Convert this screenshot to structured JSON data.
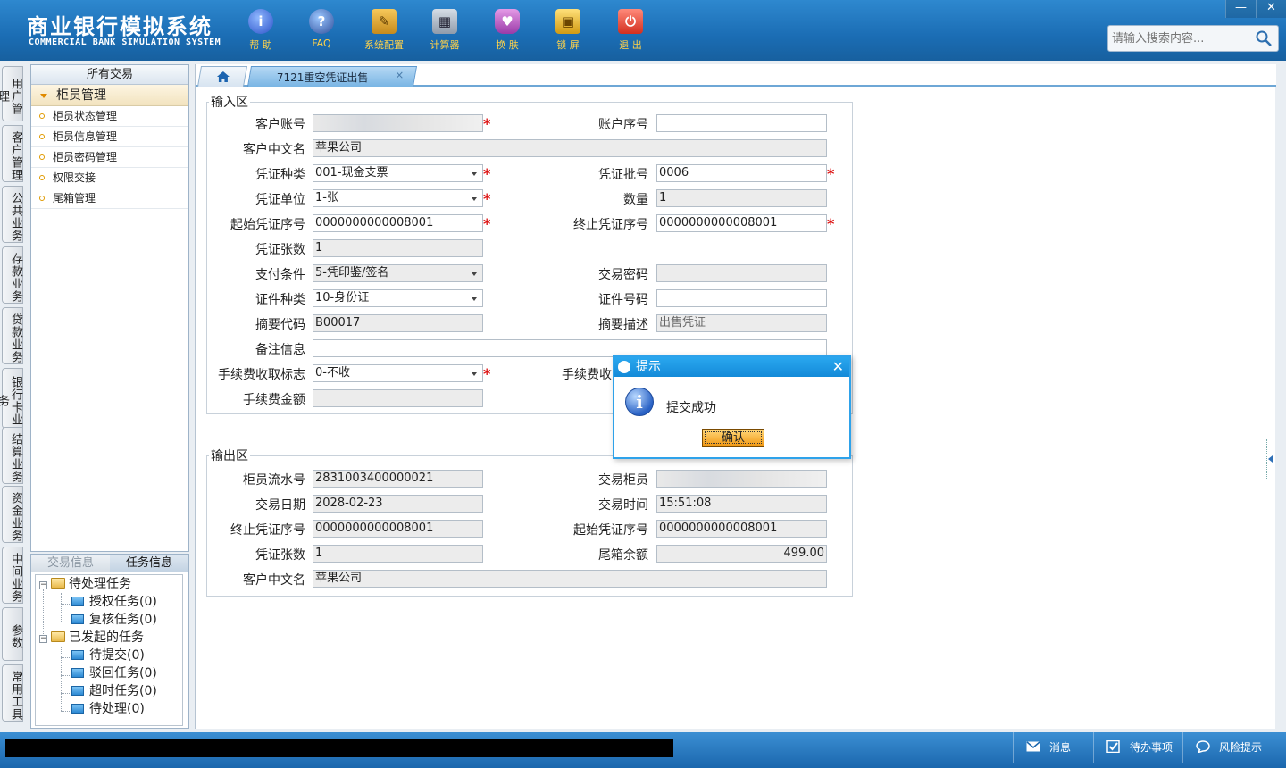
{
  "header": {
    "title_cn": "商业银行模拟系统",
    "title_en": "COMMERCIAL BANK SIMULATION SYSTEM",
    "toolbar": [
      {
        "label": "帮 助",
        "icon": "help-icon"
      },
      {
        "label": "FAQ",
        "icon": "faq-icon"
      },
      {
        "label": "系统配置",
        "icon": "settings-icon"
      },
      {
        "label": "计算器",
        "icon": "calculator-icon"
      },
      {
        "label": "换 肤",
        "icon": "skin-shirt-icon"
      },
      {
        "label": "锁 屏",
        "icon": "lock-icon"
      },
      {
        "label": "退 出",
        "icon": "exit-power-icon"
      }
    ],
    "window_buttons": {
      "minimize": "—",
      "close": "✕"
    },
    "search_placeholder": "请输入搜索内容..."
  },
  "vertical_tabs": [
    "用户管理",
    "客户管理",
    "公共业务",
    "存款业务",
    "贷款业务",
    "银行卡业务",
    "结算业务",
    "资金业务",
    "中间业务",
    "参数",
    "常用工具"
  ],
  "left_panel": {
    "header": "所有交易",
    "group": "柜员管理",
    "items": [
      "柜员状态管理",
      "柜员信息管理",
      "柜员密码管理",
      "权限交接",
      "尾箱管理"
    ]
  },
  "left_bottom": {
    "tabs": [
      "交易信息",
      "任务信息"
    ],
    "tree": [
      {
        "label": "待处理任务",
        "level": 0
      },
      {
        "label": "授权任务(0)",
        "level": 1
      },
      {
        "label": "复核任务(0)",
        "level": 1
      },
      {
        "label": "已发起的任务",
        "level": 0
      },
      {
        "label": "待提交(0)",
        "level": 1
      },
      {
        "label": "驳回任务(0)",
        "level": 1
      },
      {
        "label": "超时任务(0)",
        "level": 1
      },
      {
        "label": "待处理(0)",
        "level": 1
      }
    ]
  },
  "tabs": {
    "active": "7121重空凭证出售",
    "close": "×"
  },
  "input_area": {
    "legend": "输入区",
    "fields": {
      "customer_account": {
        "label": "客户账号",
        "value": ""
      },
      "account_seq": {
        "label": "账户序号",
        "value": ""
      },
      "customer_name": {
        "label": "客户中文名",
        "value": "苹果公司"
      },
      "voucher_type": {
        "label": "凭证种类",
        "value": "001-现金支票"
      },
      "voucher_batch": {
        "label": "凭证批号",
        "value": "0006"
      },
      "voucher_unit": {
        "label": "凭证单位",
        "value": "1-张"
      },
      "quantity": {
        "label": "数量",
        "value": "1"
      },
      "start_seq": {
        "label": "起始凭证序号",
        "value": "0000000000008001"
      },
      "end_seq": {
        "label": "终止凭证序号",
        "value": "0000000000008001"
      },
      "voucher_count": {
        "label": "凭证张数",
        "value": "1"
      },
      "payment_condition": {
        "label": "支付条件",
        "value": "5-凭印鉴/签名"
      },
      "trade_password": {
        "label": "交易密码",
        "value": ""
      },
      "id_type": {
        "label": "证件种类",
        "value": "10-身份证"
      },
      "id_number": {
        "label": "证件号码",
        "value": ""
      },
      "summary_code": {
        "label": "摘要代码",
        "value": "B00017"
      },
      "summary_desc": {
        "label": "摘要描述",
        "value": "出售凭证"
      },
      "remark": {
        "label": "备注信息",
        "value": ""
      },
      "fee_flag": {
        "label": "手续费收取标志",
        "value": "0-不收"
      },
      "fee_method": {
        "label": "手续费收",
        "value": ""
      },
      "fee_amount": {
        "label": "手续费金额",
        "value": ""
      }
    }
  },
  "output_area": {
    "legend": "输出区",
    "fields": {
      "teller_serial": {
        "label": "柜员流水号",
        "value": "2831003400000021"
      },
      "trade_teller": {
        "label": "交易柜员",
        "value": ""
      },
      "trade_date": {
        "label": "交易日期",
        "value": "2028-02-23"
      },
      "trade_time": {
        "label": "交易时间",
        "value": "15:51:08"
      },
      "end_seq": {
        "label": "终止凭证序号",
        "value": "0000000000008001"
      },
      "start_seq": {
        "label": "起始凭证序号",
        "value": "0000000000008001"
      },
      "voucher_count": {
        "label": "凭证张数",
        "value": "1"
      },
      "tail_box_balance": {
        "label": "尾箱余额",
        "value": "499.00"
      },
      "customer_name": {
        "label": "客户中文名",
        "value": "苹果公司"
      }
    }
  },
  "dialog": {
    "title": "提示",
    "message": "提交成功",
    "ok": "确认",
    "close": "✕"
  },
  "statusbar": {
    "message": "消息",
    "todo": "待办事项",
    "risk": "风险提示"
  },
  "colors": {
    "header": "#1b6db4",
    "accent": "#2ea2ea",
    "required": "#dd1111",
    "toolbar_label": "#ffd24a"
  }
}
